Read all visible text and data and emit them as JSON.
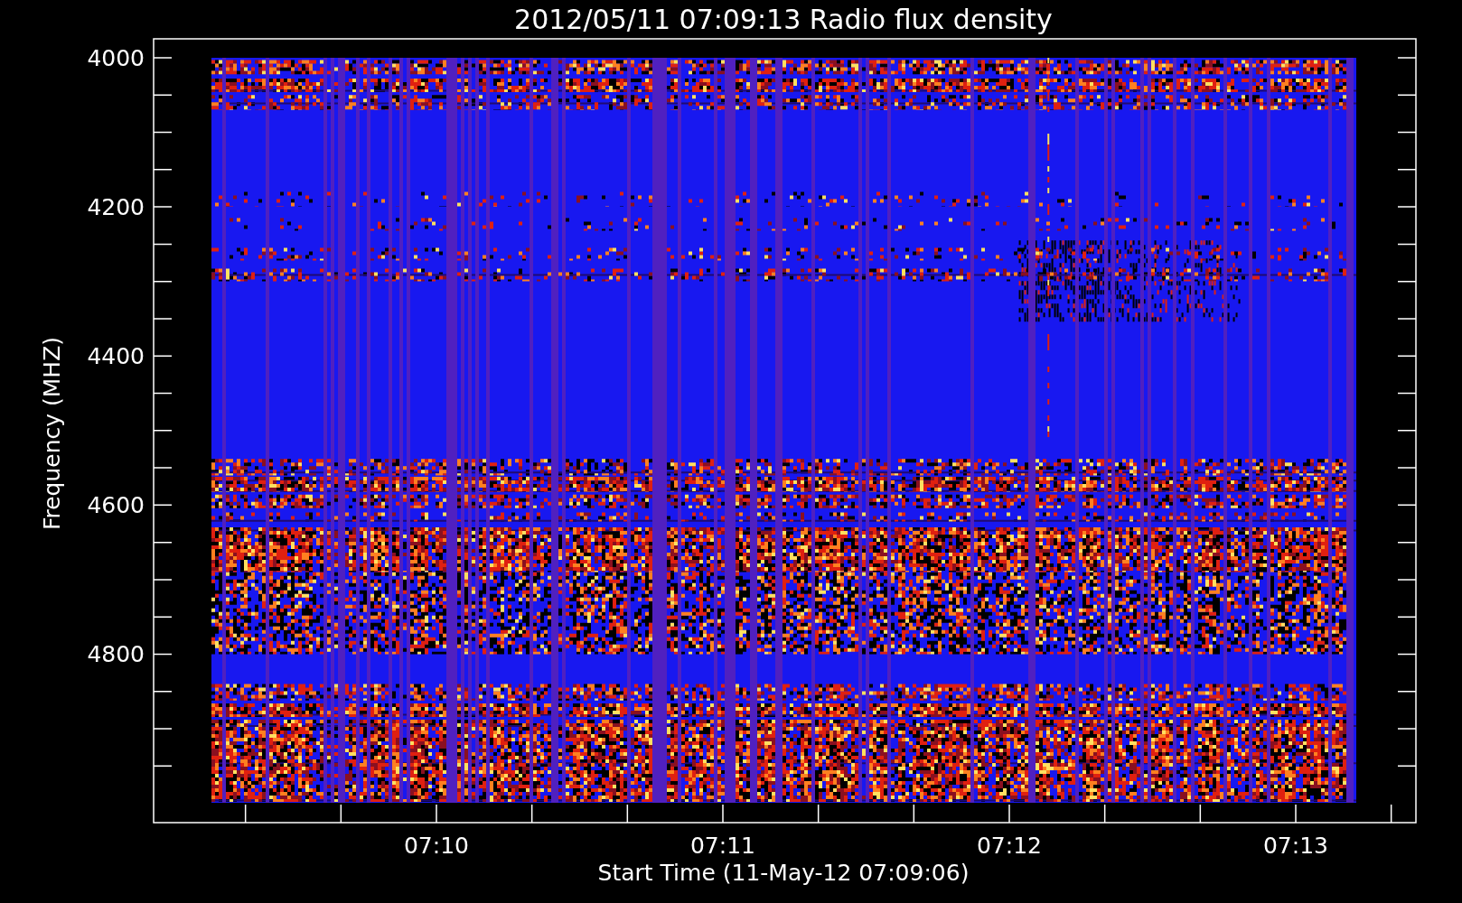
{
  "title": "2012/05/11 07:09:13 Radio flux density",
  "y_axis": {
    "label": "Frequency (MHZ)",
    "tick_labels": [
      "4000",
      "4200",
      "4400",
      "4600",
      "4800"
    ]
  },
  "x_axis": {
    "label": "Start Time (11-May-12 07:09:06)",
    "tick_labels": [
      "07:10",
      "07:11",
      "07:12",
      "07:13"
    ]
  }
}
